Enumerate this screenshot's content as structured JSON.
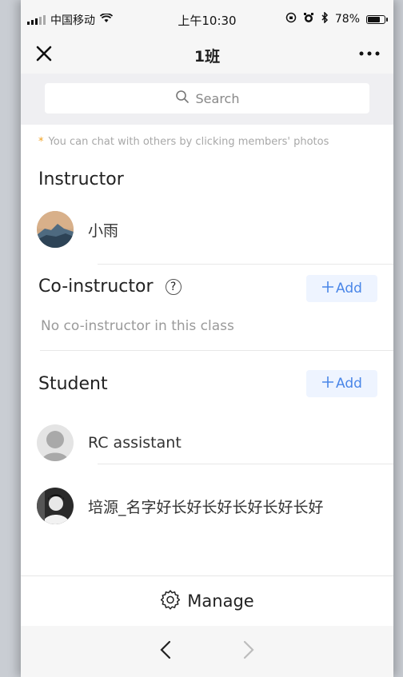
{
  "status_bar": {
    "carrier": "中国移动",
    "time": "上午10:30",
    "battery_text": "78%",
    "battery_level": 0.78
  },
  "nav": {
    "title": "1班"
  },
  "search": {
    "placeholder": "Search"
  },
  "hint": {
    "star": "*",
    "text": "You can chat with others by clicking members' photos"
  },
  "instructor": {
    "title": "Instructor",
    "members": [
      {
        "name": "小雨",
        "avatar": "mountain-photo"
      }
    ]
  },
  "co_instructor": {
    "title": "Co-instructor",
    "help": "?",
    "add_label": "Add",
    "empty_text": "No co-instructor in this class"
  },
  "student": {
    "title": "Student",
    "add_label": "Add",
    "members": [
      {
        "name": "RC assistant",
        "avatar": "default-person"
      },
      {
        "name": "培源_名字好长好长好长好长好长好",
        "avatar": "person-photo"
      }
    ]
  },
  "bottom": {
    "manage_label": "Manage"
  },
  "browser_nav": {
    "back_enabled": true,
    "forward_enabled": false
  }
}
